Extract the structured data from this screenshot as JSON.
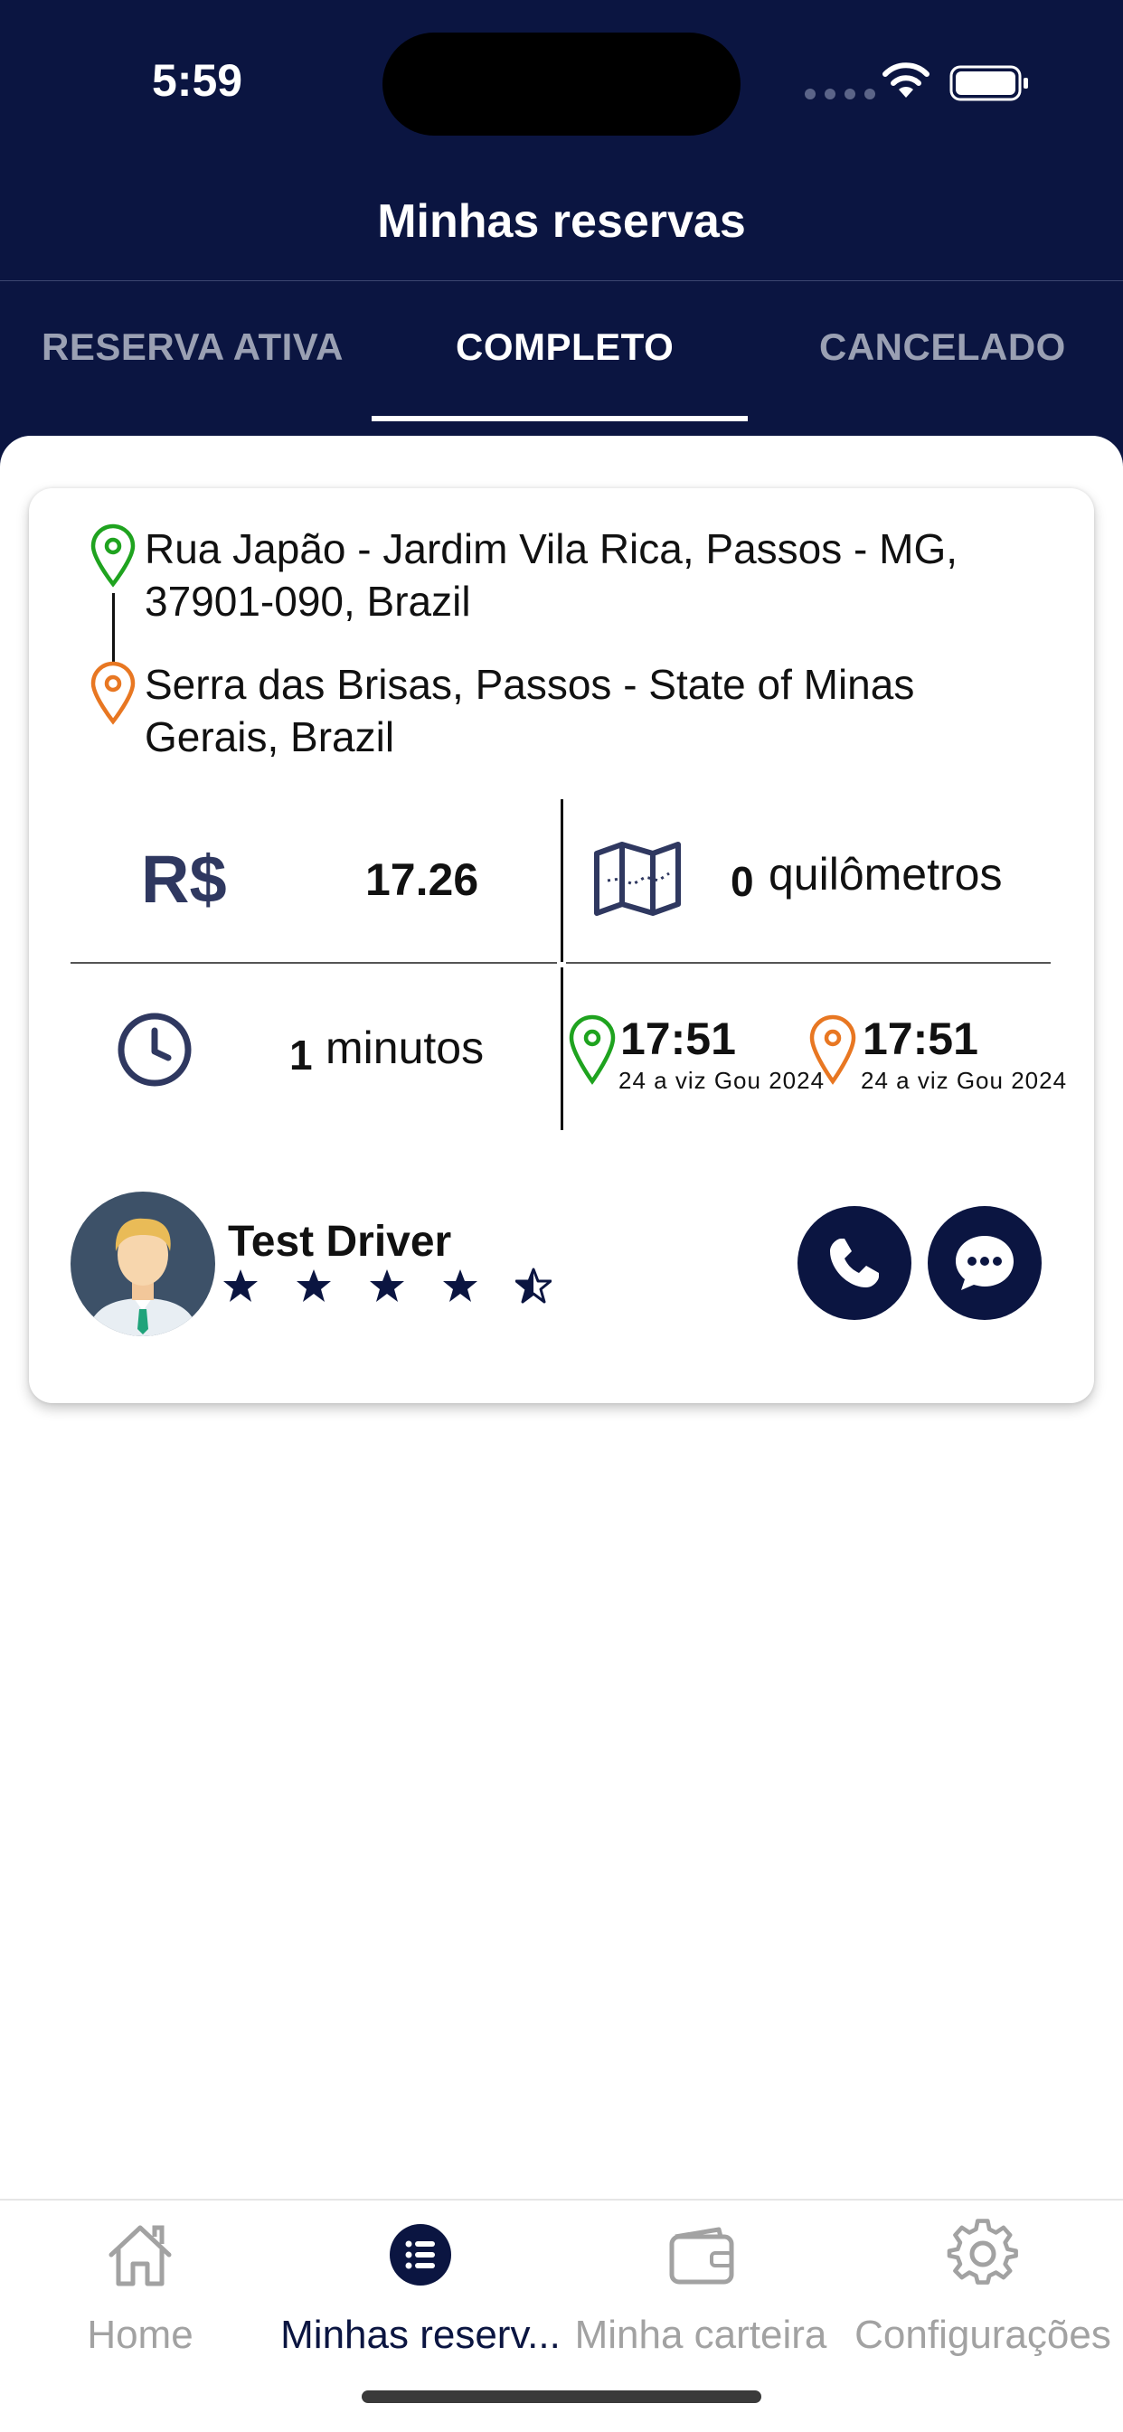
{
  "status_bar": {
    "time": "5:59"
  },
  "header": {
    "title": "Minhas reservas"
  },
  "tabs": [
    {
      "label": "RESERVA ATIVA",
      "active": false
    },
    {
      "label": "COMPLETO",
      "active": true
    },
    {
      "label": "CANCELADO",
      "active": false
    }
  ],
  "booking": {
    "pickup_address": "Rua Japão - Jardim Vila Rica, Passos - MG, 37901-090, Brazil",
    "dropoff_address": "Serra das Brisas, Passos - State of Minas Gerais, Brazil",
    "currency_symbol": "R$",
    "fare": "17.26",
    "distance_value": "0",
    "distance_unit": "quilômetros",
    "duration_value": "1",
    "duration_unit": "minutos",
    "pickup_time": "17:51",
    "pickup_date": "24 a viz Gou 2024",
    "dropoff_time": "17:51",
    "dropoff_date": "24 a viz Gou 2024",
    "pickup_pin_color": "#1fa31f",
    "dropoff_pin_color": "#e87722"
  },
  "driver": {
    "name": "Test Driver",
    "rating": 4.5,
    "rating_max": 5
  },
  "bottom_nav": [
    {
      "label": "Home",
      "icon": "home-icon",
      "active": false
    },
    {
      "label": "Minhas reserv...",
      "icon": "list-icon",
      "active": true
    },
    {
      "label": "Minha carteira",
      "icon": "wallet-icon",
      "active": false
    },
    {
      "label": "Configurações",
      "icon": "gear-icon",
      "active": false
    }
  ],
  "colors": {
    "primary": "#0b1541",
    "inactive_tab": "#9aa0b3",
    "nav_inactive": "#a2a2a2"
  }
}
